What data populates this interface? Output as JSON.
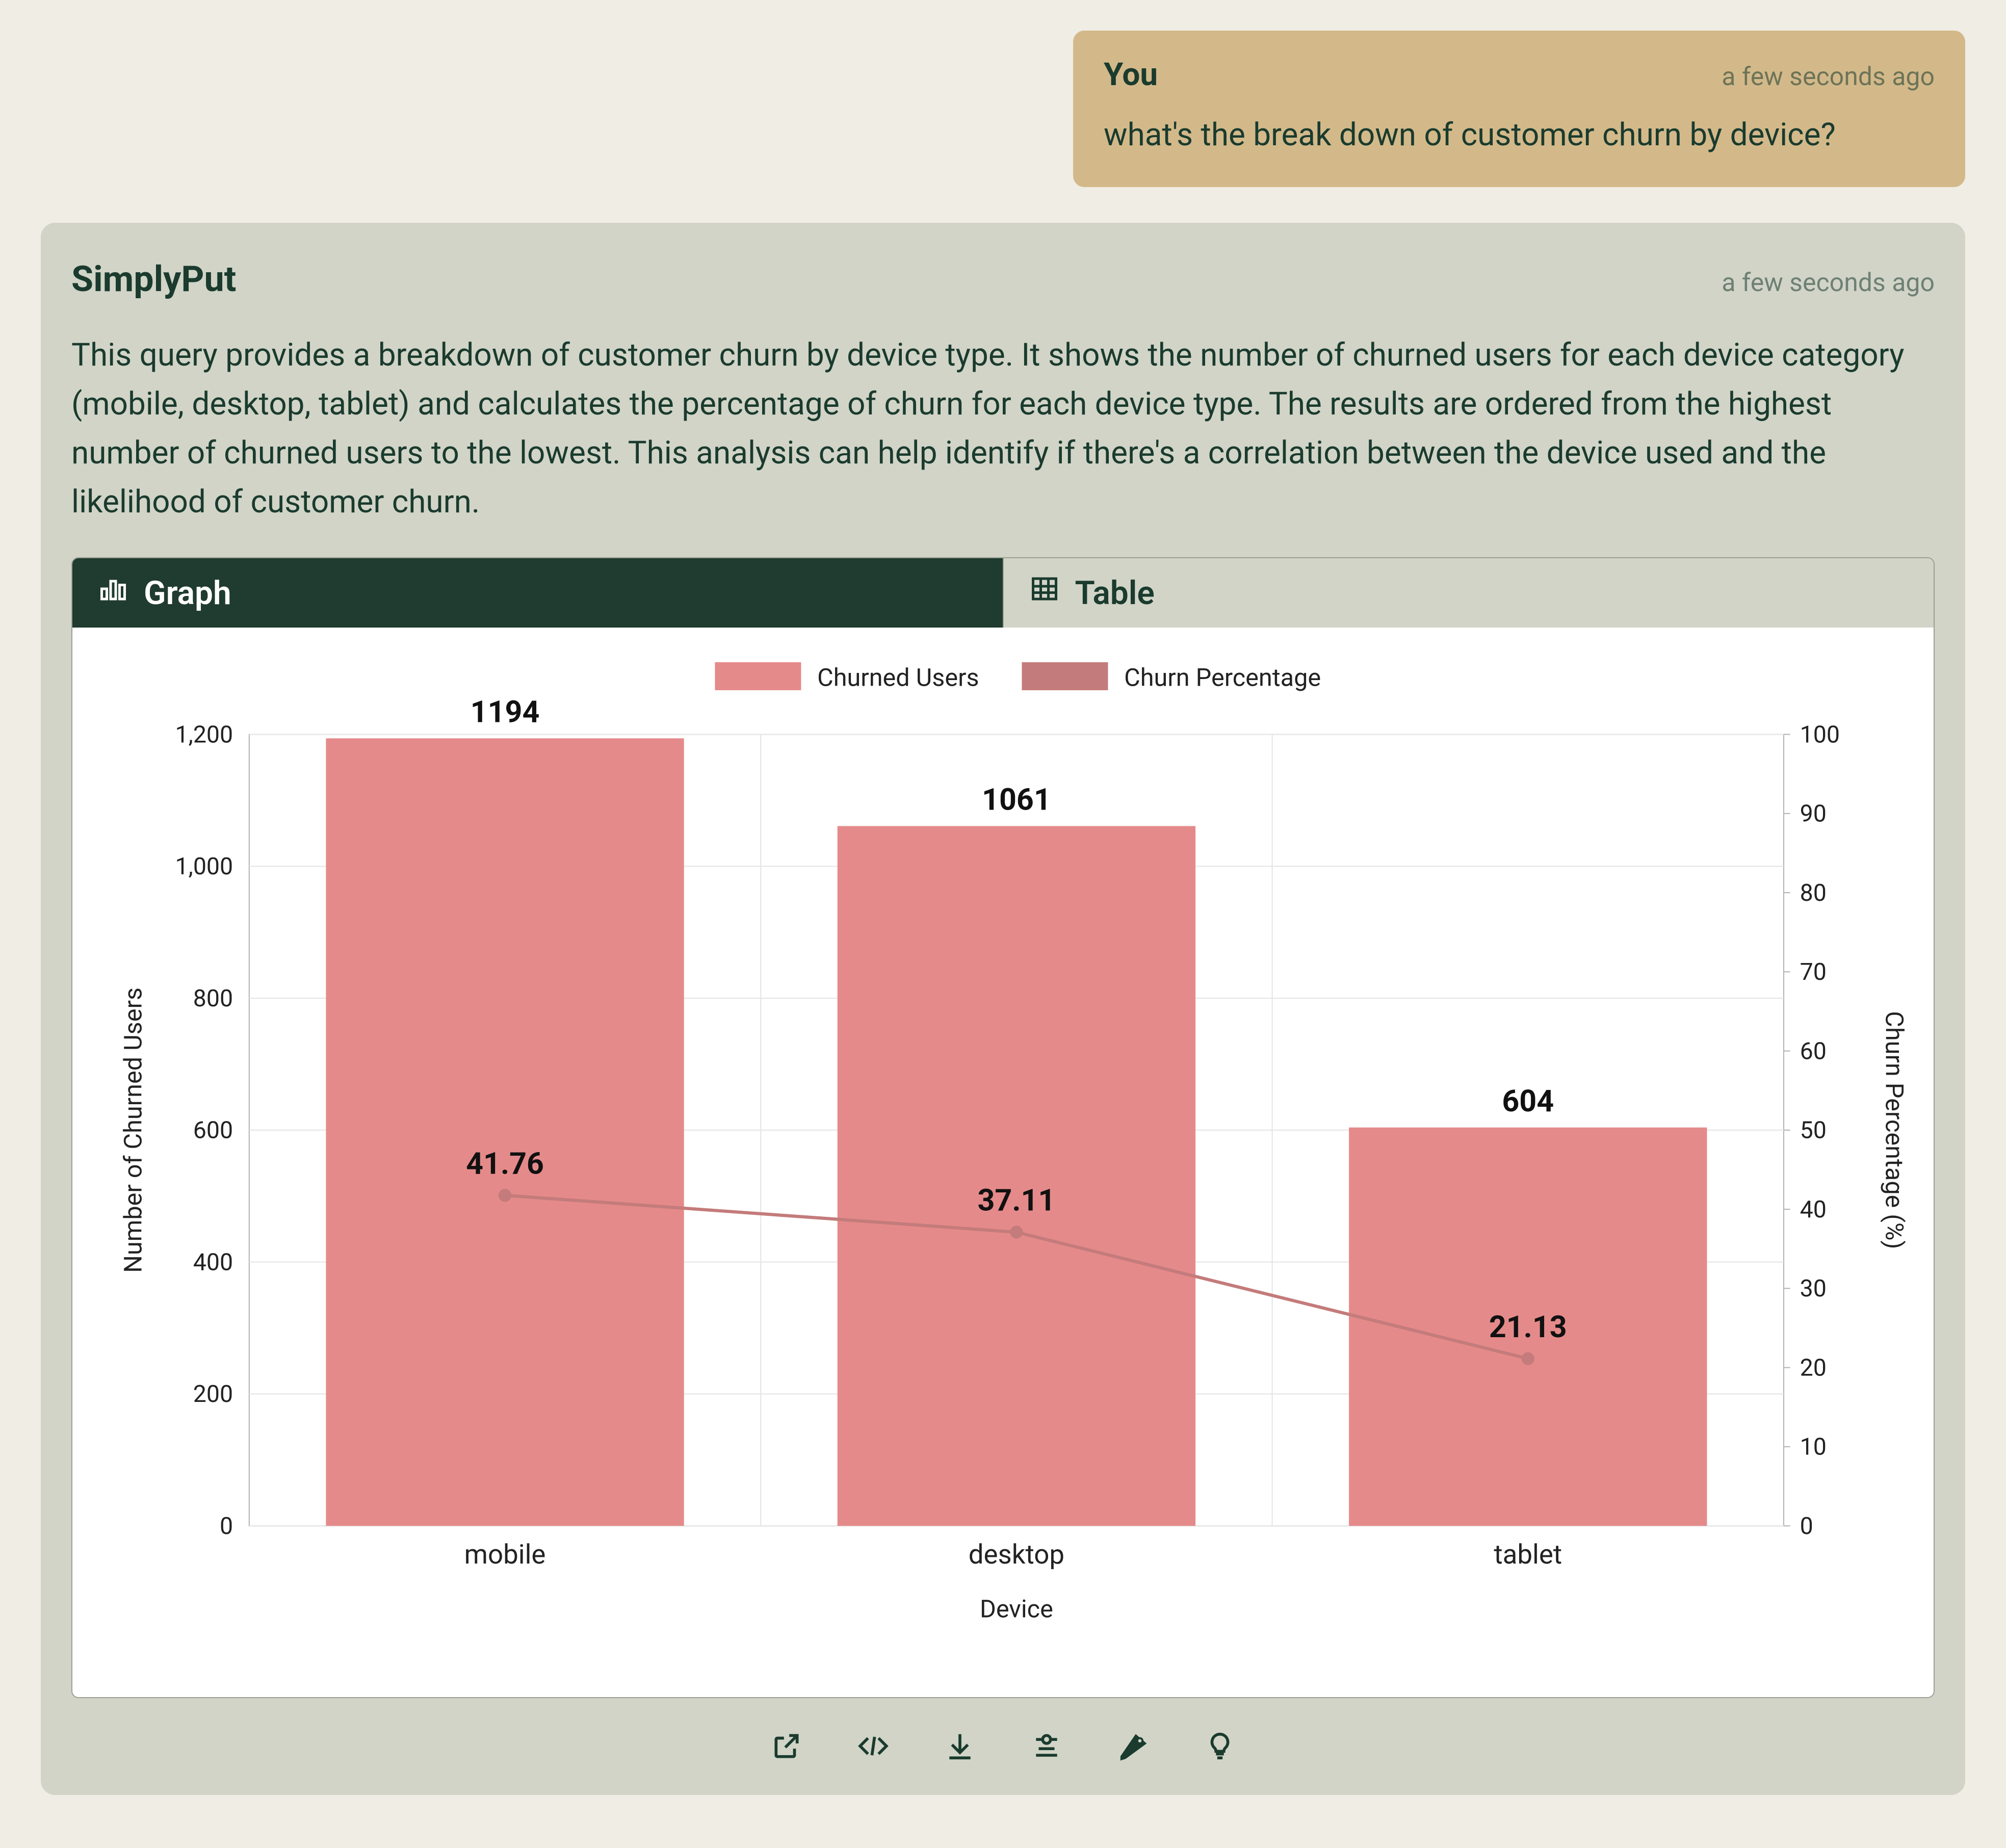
{
  "user": {
    "name": "You",
    "timestamp": "a few seconds ago",
    "message": "what's the break down of customer churn by device?"
  },
  "assistant": {
    "name": "SimplyPut",
    "timestamp": "a few seconds ago",
    "body": "This query provides a breakdown of customer churn by device type. It shows the number of churned users for each device category (mobile, desktop, tablet) and calculates the percentage of churn for each device type. The results are ordered from the highest number of churned users to the lowest. This analysis can help identify if there's a correlation between the device used and the likelihood of customer churn."
  },
  "tabs": {
    "graph": "Graph",
    "table": "Table"
  },
  "legend": {
    "series_a": "Churned Users",
    "series_b": "Churn Percentage"
  },
  "axes": {
    "y_left_label": "Number of Churned Users",
    "y_right_label": "Churn Percentage (%)",
    "x_label": "Device"
  },
  "y_left_ticks": [
    "0",
    "200",
    "400",
    "600",
    "800",
    "1,000",
    "1,200"
  ],
  "y_right_ticks": [
    "0",
    "10",
    "20",
    "30",
    "40",
    "50",
    "60",
    "70",
    "80",
    "90",
    "100"
  ],
  "categories": [
    "mobile",
    "desktop",
    "tablet"
  ],
  "bar_labels": [
    "1194",
    "1061",
    "604"
  ],
  "line_labels": [
    "41.76",
    "37.11",
    "21.13"
  ],
  "actions": {
    "open": "Open in new window",
    "code": "View code",
    "download": "Download",
    "settings": "Chart settings",
    "feedback": "Send feedback",
    "insight": "Insight"
  },
  "chart_data": {
    "type": "bar",
    "title": "",
    "xlabel": "Device",
    "ylabel": "Number of Churned Users",
    "y2label": "Churn Percentage (%)",
    "categories": [
      "mobile",
      "desktop",
      "tablet"
    ],
    "series": [
      {
        "name": "Churned Users",
        "axis": "left",
        "type": "bar",
        "values": [
          1194,
          1061,
          604
        ]
      },
      {
        "name": "Churn Percentage",
        "axis": "right",
        "type": "line",
        "values": [
          41.76,
          37.11,
          21.13
        ]
      }
    ],
    "ylim_left": [
      0,
      1200
    ],
    "ylim_right": [
      0,
      100
    ],
    "grid": true,
    "legend_position": "top"
  }
}
